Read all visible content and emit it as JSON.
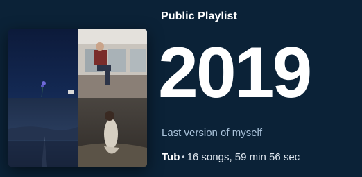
{
  "playlist": {
    "kind_label": "Public Playlist",
    "title": "2019",
    "description": "Last version of myself",
    "owner": "Tub",
    "separator": "•",
    "stats": "16 songs, 59 min 56 sec"
  },
  "cover": {
    "tiles": [
      "album-art-night-flower",
      "album-art-person-window",
      "album-art-stormy-road",
      "album-art-figure-in-field"
    ]
  },
  "colors": {
    "background": "#0b2237",
    "description_text": "#a9c2da",
    "title_text": "#ffffff"
  }
}
